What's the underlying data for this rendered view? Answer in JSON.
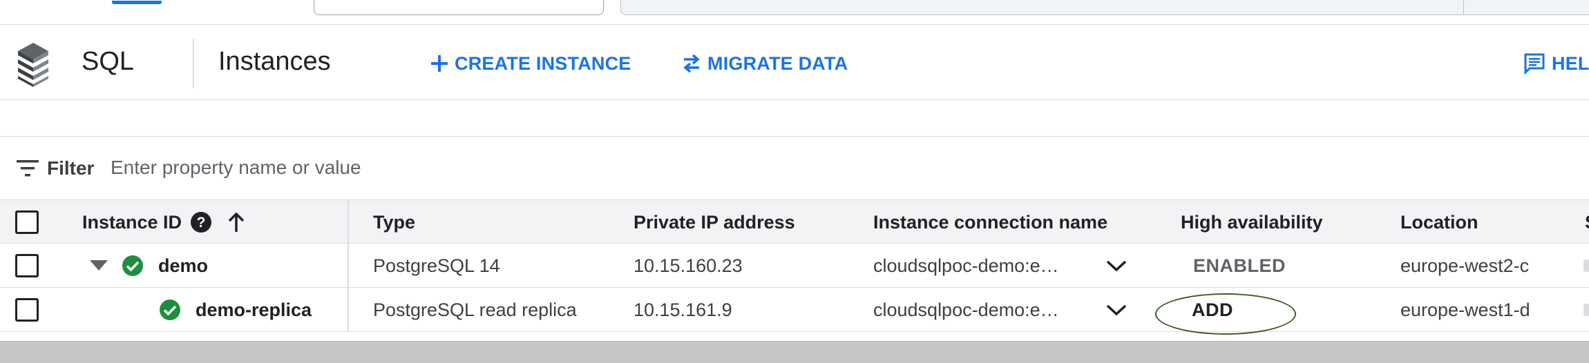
{
  "colors": {
    "accent": "#1a73e8",
    "success": "#1e8e3e",
    "annotation": "#3d5a2b"
  },
  "header": {
    "product": "SQL",
    "product_icon": "sql-stack-icon",
    "title": "Instances",
    "actions": [
      {
        "label": "CREATE INSTANCE",
        "icon": "plus-icon"
      },
      {
        "label": "MIGRATE DATA",
        "icon": "swap-arrows-icon"
      },
      {
        "label": "HEL",
        "icon": "help-feedback-icon"
      }
    ]
  },
  "filter": {
    "label": "Filter",
    "icon": "filter-lines-icon",
    "placeholder": "Enter property name or value"
  },
  "table": {
    "columns": [
      "Instance ID",
      "Type",
      "Private IP address",
      "Instance connection name",
      "High availability",
      "Location",
      "S"
    ],
    "sort_icon": "arrow-up-icon",
    "help_icon": "help-circle-icon",
    "rows": [
      {
        "id": "demo",
        "status_icon": "check-circle-icon",
        "expander_icon": "triangle-down-icon",
        "type": "PostgreSQL 14",
        "private_ip": "10.15.160.23",
        "connection_name": "cloudsqlpoc-demo:e…",
        "high_availability": "ENABLED",
        "location": "europe-west2-c"
      },
      {
        "id": "demo-replica",
        "status_icon": "check-circle-icon",
        "type": "PostgreSQL read replica",
        "private_ip": "10.15.161.9",
        "connection_name": "cloudsqlpoc-demo:e…",
        "high_availability": "ADD",
        "location": "europe-west1-d"
      }
    ]
  }
}
